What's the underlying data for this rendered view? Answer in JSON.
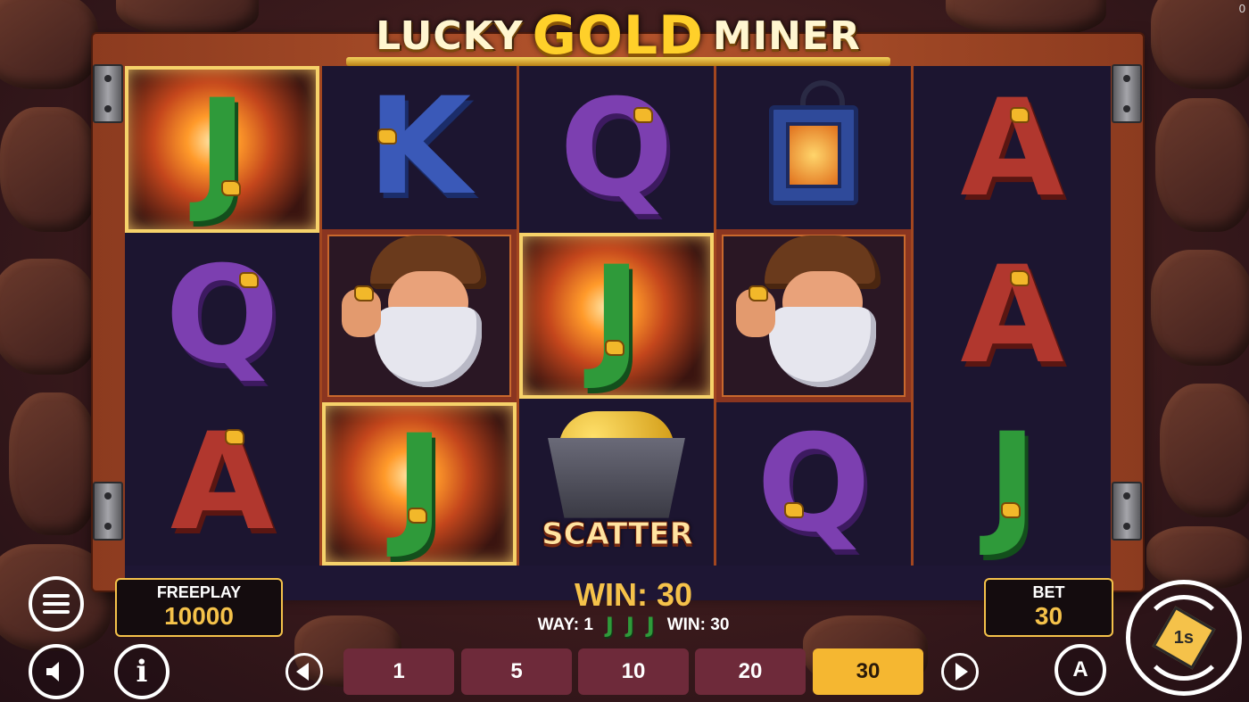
{
  "game": {
    "title_part1": "LUCKY",
    "title_part2": "GOLD",
    "title_part3": "MINER",
    "corner_counter": "0"
  },
  "reels": [
    [
      {
        "symbol": "J",
        "highlighted": true
      },
      {
        "symbol": "Q",
        "highlighted": false
      },
      {
        "symbol": "A",
        "highlighted": false
      }
    ],
    [
      {
        "symbol": "K",
        "highlighted": false
      },
      {
        "symbol": "miner",
        "highlighted": false
      },
      {
        "symbol": "J",
        "highlighted": true
      }
    ],
    [
      {
        "symbol": "Q",
        "highlighted": false
      },
      {
        "symbol": "J",
        "highlighted": true
      },
      {
        "symbol": "scatter",
        "highlighted": false,
        "label": "SCATTER"
      }
    ],
    [
      {
        "symbol": "lantern",
        "highlighted": false
      },
      {
        "symbol": "miner",
        "highlighted": false
      },
      {
        "symbol": "Q",
        "highlighted": false
      }
    ],
    [
      {
        "symbol": "A",
        "highlighted": false
      },
      {
        "symbol": "A",
        "highlighted": false
      },
      {
        "symbol": "J",
        "highlighted": false
      }
    ]
  ],
  "balance": {
    "label": "FREEPLAY",
    "value": "10000"
  },
  "win": {
    "main": "WIN: 30",
    "way_label": "WAY: 1",
    "way_symbols": [
      "J",
      "J",
      "J"
    ],
    "way_win": "WIN: 30"
  },
  "bet": {
    "label": "BET",
    "value": "30",
    "options": [
      "1",
      "5",
      "10",
      "20",
      "30"
    ],
    "selected": "30"
  },
  "controls": {
    "menu_icon": "hamburger-icon",
    "sound_icon": "speaker-icon",
    "info_icon": "info-icon",
    "info_glyph": "i",
    "autoplay_icon": "autoplay-icon",
    "autoplay_glyph": "A",
    "spin_icon": "spin-icon",
    "spin_glyph": "1s"
  },
  "colors": {
    "accent_gold": "#f5c24a",
    "bet_option_bg": "#6e2a3a",
    "bet_option_active_bg": "#f5b731",
    "frame_wood": "#b4542c"
  }
}
